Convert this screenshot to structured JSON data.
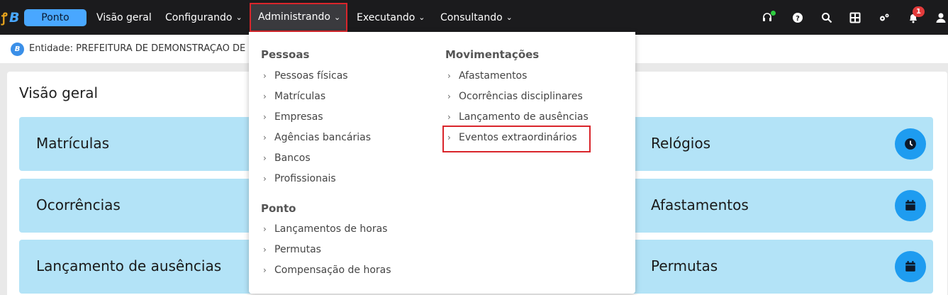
{
  "topbar": {
    "app_name": "Ponto",
    "nav": {
      "visao_geral": "Visão geral",
      "configurando": "Configurando",
      "administrando": "Administrando",
      "executando": "Executando",
      "consultando": "Consultando"
    },
    "chevron": "❯",
    "notification_count": "1",
    "icons": [
      "headset-icon",
      "help-icon",
      "search-icon",
      "grid-icon",
      "settings-icon",
      "bell-icon",
      "user-icon"
    ]
  },
  "entity": {
    "badge": "B",
    "text": "Entidade: PREFEITURA DE DEMONSTRAÇÃO DE"
  },
  "overview": {
    "title": "Visão geral",
    "tiles_left": [
      "Matrículas",
      "Ocorrências",
      "Lançamento de ausências"
    ],
    "tiles_right": [
      "Relógios",
      "Afastamentos",
      "Permutas"
    ],
    "tile_icons_right": [
      "clock-icon",
      "calendar-icon",
      "calendar-icon"
    ]
  },
  "menu": {
    "arrow": "›",
    "pessoas": {
      "heading": "Pessoas",
      "items": [
        "Pessoas físicas",
        "Matrículas",
        "Empresas",
        "Agências bancárias",
        "Bancos",
        "Profissionais"
      ]
    },
    "ponto": {
      "heading": "Ponto",
      "items": [
        "Lançamentos de horas",
        "Permutas",
        "Compensação de horas"
      ]
    },
    "movimentacoes": {
      "heading": "Movimentações",
      "items": [
        "Afastamentos",
        "Ocorrências disciplinares",
        "Lançamento de ausências",
        "Eventos extraordinários"
      ]
    }
  },
  "colors": {
    "topbar": "#1b1b1d",
    "accent": "#49a7ff",
    "tile_bg": "#b3e3f7",
    "tile_icon": "#1e9cf0",
    "highlight": "#d9252b"
  }
}
